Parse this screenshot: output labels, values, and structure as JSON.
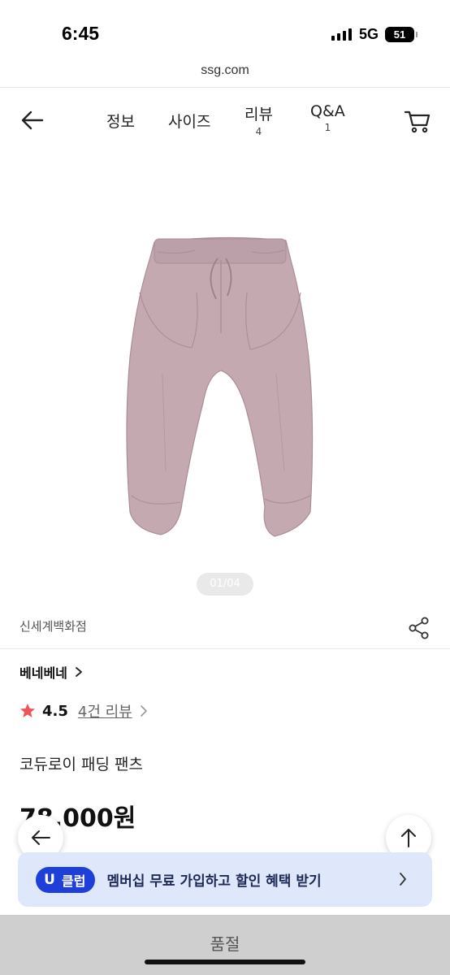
{
  "status_bar": {
    "time": "6:45",
    "network": "5G",
    "battery": "51"
  },
  "browser": {
    "url": "ssg.com"
  },
  "nav": {
    "tabs": [
      {
        "label": "정보",
        "count": ""
      },
      {
        "label": "사이즈",
        "count": ""
      },
      {
        "label": "리뷰",
        "count": "4"
      },
      {
        "label": "Q&A",
        "count": "1"
      }
    ]
  },
  "gallery": {
    "pager": "01/04",
    "product_color": "#c4a9b1"
  },
  "product": {
    "seller": "신세계백화점",
    "brand": "베네베네",
    "rating": "4.5",
    "review_link": "4건 리뷰",
    "title": "코듀로이 패딩 팬츠",
    "price": "78,000원"
  },
  "banner": {
    "badge_letter": "U",
    "badge_text": "클럽",
    "text": "멤버십 무료 가입하고 할인 혜택 받기",
    "accent": "#1e3fd8"
  },
  "bottom": {
    "soldout_label": "품절"
  },
  "colors": {
    "star": "#f0525a",
    "banner_bg": "#dfe7fb",
    "soldout_bg": "#cfcfcf"
  }
}
